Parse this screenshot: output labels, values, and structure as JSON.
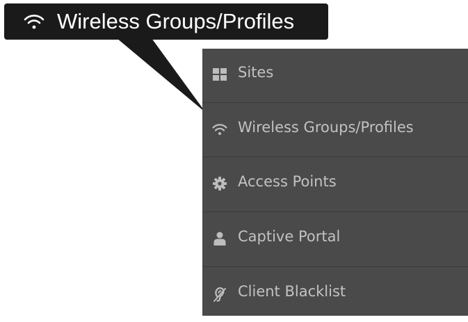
{
  "callout": {
    "label": "Wireless Groups/Profiles",
    "icon": "wifi-icon",
    "background": "#1a1a1a",
    "text_color": "#ffffff"
  },
  "menu": {
    "background": "#4a4a4a",
    "text_color": "#c2c2c2",
    "items": [
      {
        "label": "Sites",
        "icon": "grid-icon"
      },
      {
        "label": "Wireless Groups/Profiles",
        "icon": "wifi-icon"
      },
      {
        "label": "Access Points",
        "icon": "gear-icon"
      },
      {
        "label": "Captive Portal",
        "icon": "user-icon"
      },
      {
        "label": "Client Blacklist",
        "icon": "deaf-icon"
      }
    ]
  }
}
